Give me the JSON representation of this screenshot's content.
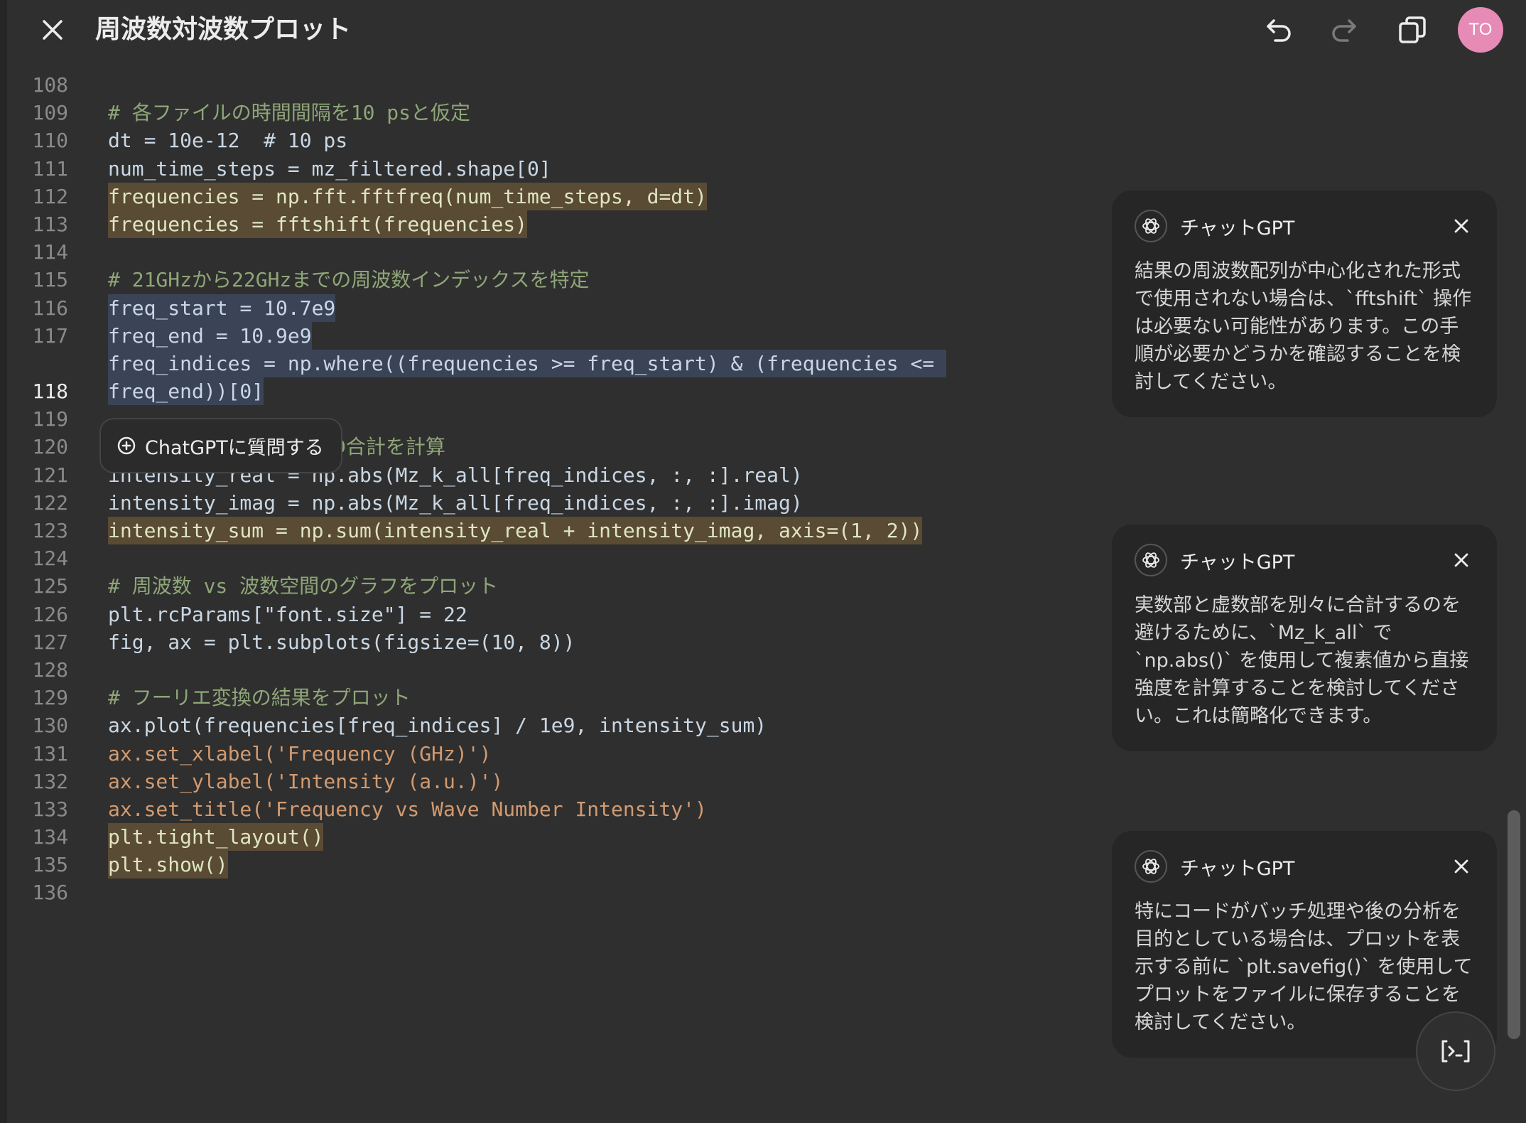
{
  "header": {
    "title": "周波数対波数プロット",
    "avatar_initials": "TO"
  },
  "code": {
    "active_line": "118",
    "lines": [
      {
        "n": "108",
        "text": ""
      },
      {
        "n": "109",
        "text": "# 各ファイルの時間間隔を10 psと仮定"
      },
      {
        "n": "110",
        "text": "dt = 10e-12  # 10 ps"
      },
      {
        "n": "111",
        "text": "num_time_steps = mz_filtered.shape[0]"
      },
      {
        "n": "112",
        "text": "frequencies = np.fft.fftfreq(num_time_steps, d=dt)"
      },
      {
        "n": "113",
        "text": "frequencies = fftshift(frequencies)"
      },
      {
        "n": "114",
        "text": ""
      },
      {
        "n": "115",
        "text": "# 21GHzから22GHzまでの周波数インデックスを特定"
      },
      {
        "n": "116",
        "text": "freq_start = 10.7e9"
      },
      {
        "n": "117",
        "text": "freq_end = 10.9e9"
      },
      {
        "n": "118",
        "text": "freq_indices = np.where((frequencies >= freq_start) & (frequencies <= ",
        "text2": "freq_end))[0]"
      },
      {
        "n": "119",
        "text": ""
      },
      {
        "n": "120",
        "text": "D合計を計算"
      },
      {
        "n": "121",
        "text": "intensity_real = np.abs(Mz_k_all[freq_indices, :, :].real)"
      },
      {
        "n": "122",
        "text": "intensity_imag = np.abs(Mz_k_all[freq_indices, :, :].imag)"
      },
      {
        "n": "123",
        "text": "intensity_sum = np.sum(intensity_real + intensity_imag, axis=(1, 2))"
      },
      {
        "n": "124",
        "text": ""
      },
      {
        "n": "125",
        "text": "# 周波数 vs 波数空間のグラフをプロット"
      },
      {
        "n": "126",
        "text": "plt.rcParams[\"font.size\"] = 22"
      },
      {
        "n": "127",
        "text": "fig, ax = plt.subplots(figsize=(10, 8))"
      },
      {
        "n": "128",
        "text": ""
      },
      {
        "n": "129",
        "text": "# フーリエ変換の結果をプロット"
      },
      {
        "n": "130",
        "text": "ax.plot(frequencies[freq_indices] / 1e9, intensity_sum)"
      },
      {
        "n": "131",
        "text": "ax.set_xlabel('Frequency (GHz)')"
      },
      {
        "n": "132",
        "text": "ax.set_ylabel('Intensity (a.u.)')"
      },
      {
        "n": "133",
        "text": "ax.set_title('Frequency vs Wave Number Intensity')"
      },
      {
        "n": "134",
        "text": "plt.tight_layout()"
      },
      {
        "n": "135",
        "text": "plt.show()"
      },
      {
        "n": "136",
        "text": ""
      }
    ]
  },
  "ask_button": {
    "label": "ChatGPTに質問する"
  },
  "comments": [
    {
      "author": "チャットGPT",
      "body": "結果の周波数配列が中心化された形式で使用されない場合は、`fftshift` 操作は必要ない可能性があります。この手順が必要かどうかを確認することを検討してください。"
    },
    {
      "author": "チャットGPT",
      "body": "実数部と虚数部を別々に合計するのを避けるために、`Mz_k_all` で `np.abs()` を使用して複素値から直接強度を計算することを検討してください。これは簡略化できます。"
    },
    {
      "author": "チャットGPT",
      "body": "特にコードがバッチ処理や後の分析を目的としている場合は、プロットを表示する前に `plt.savefig()` を使用してプロットをファイルに保存することを検討してください。"
    }
  ],
  "colors": {
    "background": "#2f2f2f",
    "card": "#262626",
    "highlight_yellow": "#5a4b34",
    "highlight_blue": "#3a4456",
    "comment_text": "#8fa678",
    "string_text": "#d29a70",
    "avatar": "#e68ab6"
  },
  "icons": [
    "close-icon",
    "undo-icon",
    "redo-icon",
    "copy-icon",
    "chatgpt-logo-icon",
    "add-comment-icon",
    "code-review-icon"
  ]
}
